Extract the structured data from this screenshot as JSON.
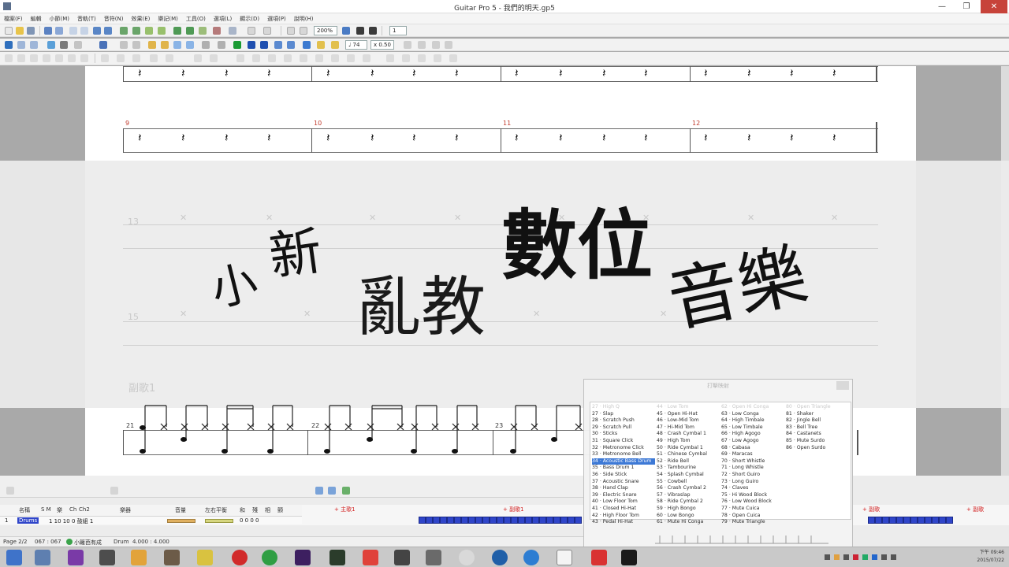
{
  "window": {
    "title": "Guitar Pro 5 - 我們的明天.gp5",
    "min_glyph": "—",
    "max_glyph": "❐",
    "close_glyph": "✕"
  },
  "menu": [
    "檔案(F)",
    "編輯",
    "小節(M)",
    "音軌(T)",
    "音符(N)",
    "效果(E)",
    "樂記(M)",
    "工具(O)",
    "選項(L)",
    "顯示(D)",
    "選項(P)",
    "說明(H)"
  ],
  "toolbar": {
    "zoom_value": "200%",
    "page_value": "1",
    "tempo_value": "♩ 74",
    "speed_value": "x 0.50"
  },
  "score": {
    "bars_row1": [
      "9",
      "10",
      "11",
      "12"
    ],
    "bars_row3": [
      "21",
      "22",
      "23"
    ],
    "ghost_row": [
      "13",
      "15"
    ],
    "rest_glyph": "𝄽",
    "ghost_x_glyph": "✕",
    "section_label": "副歌1"
  },
  "overlay": {
    "line1_a": "小",
    "line1_b": "新",
    "line2": "亂教",
    "line3": "數位",
    "line4": "音樂"
  },
  "drum_panel": {
    "title": "打擊映射",
    "col1": [
      "27 · Slap",
      "28 · Scratch Push",
      "29 · Scratch Pull",
      "30 · Sticks",
      "31 · Square Click",
      "32 · Metronome Click",
      "33 · Metronome Bell",
      "34 · Acoustic Bass Drum",
      "35 · Bass Drum 1",
      "36 · Side Stick",
      "37 · Acoustic Snare",
      "38 · Hand Clap",
      "39 · Electric Snare",
      "40 · Low Floor Tom",
      "41 · Closed Hi-Hat",
      "42 · High Floor Tom",
      "43 · Pedal Hi-Hat"
    ],
    "col1_header": "27 · High Q",
    "col1_selected_index": 7,
    "col2_header": "44 · Low Tom",
    "col2": [
      "45 · Open Hi-Hat",
      "46 · Low-Mid Tom",
      "47 · Hi-Mid Tom",
      "48 · Crash Cymbal 1",
      "49 · High Tom",
      "50 · Ride Cymbal 1",
      "51 · Chinese Cymbal",
      "52 · Ride Bell",
      "53 · Tambourine",
      "54 · Splash Cymbal",
      "55 · Cowbell",
      "56 · Crash Cymbal 2",
      "57 · Vibraslap",
      "58 · Ride Cymbal 2",
      "59 · High Bongo",
      "60 · Low Bongo",
      "61 · Mute Hi Conga"
    ],
    "col3_header": "62 · Open Hi Conga",
    "col3": [
      "63 · Low Conga",
      "64 · High Timbale",
      "65 · Low Timbale",
      "66 · High Agogo",
      "67 · Low Agogo",
      "68 · Cabasa",
      "69 · Maracas",
      "70 · Short Whistle",
      "71 · Long Whistle",
      "72 · Short Guiro",
      "73 · Long Guiro",
      "74 · Claves",
      "75 · Hi Wood Block",
      "76 · Low Wood Block",
      "77 · Mute Cuica",
      "78 · Open Cuica",
      "79 · Mute Triangle"
    ],
    "col4_header": "80 · Open Triangle",
    "col4": [
      "81 · Shaker",
      "82 · Jingle Bell",
      "83 · Bell Tree",
      "84 · Castanets",
      "85 · Mute Surdo",
      "86 · Open Surdo"
    ]
  },
  "track_header": {
    "labels": [
      "名稱",
      "S M",
      "樂",
      "Ch",
      "Ch2",
      "樂器",
      "音量",
      "左右平衡",
      "和",
      "殘",
      "相",
      "顫"
    ],
    "row_num": "1",
    "row_name": "Drums",
    "row_vals": "1   10   10   0  鼓組 1",
    "row_tail": "0   0   0   0"
  },
  "timeline": {
    "marker1": "+ 主歌1",
    "marker2": "+ 副歌1",
    "marker3": "+ 副歌",
    "marker4": "+ 副歌"
  },
  "status": {
    "page": "Page 2/2",
    "bar": "067 : 067",
    "song": "小籬芭有成",
    "track": "Drum",
    "time": "4.000 : 4.000"
  },
  "tray": {
    "time": "下午 09:46",
    "date": "2015/07/22"
  },
  "colors": {
    "accent_blue": "#2f45c9",
    "marker_red": "#d21f1f",
    "selection": "#3d79d6",
    "close_red": "#c7433a"
  }
}
